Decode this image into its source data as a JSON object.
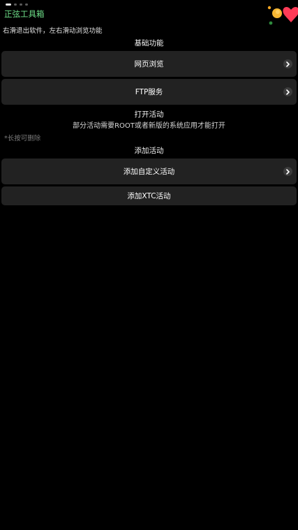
{
  "header": {
    "app_title": "正弦工具箱",
    "hint": "右滑退出软件，左右滑动浏览功能",
    "page_indicator": {
      "total": 4,
      "active_index": 0
    }
  },
  "sections": {
    "basic": {
      "title": "基础功能",
      "items": [
        {
          "label": "网页浏览",
          "icon": "chevron-right-icon"
        },
        {
          "label": "FTP服务",
          "icon": "chevron-right-icon"
        }
      ]
    },
    "open_activity": {
      "title": "打开活动",
      "subtitle": "部分活动需要ROOT或者新版的系统应用才能打开",
      "note": "*长按可删除"
    },
    "add_activity": {
      "title": "添加活动",
      "items": [
        {
          "label": "添加自定义活动",
          "icon": "chevron-right-icon"
        },
        {
          "label": "添加XTC活动"
        }
      ]
    }
  },
  "colors": {
    "background": "#000000",
    "row_background": "#222222",
    "title_accent": "#6fe08a",
    "note_text": "#7a7a7a",
    "chevron_bg": "#3c3c3c"
  }
}
